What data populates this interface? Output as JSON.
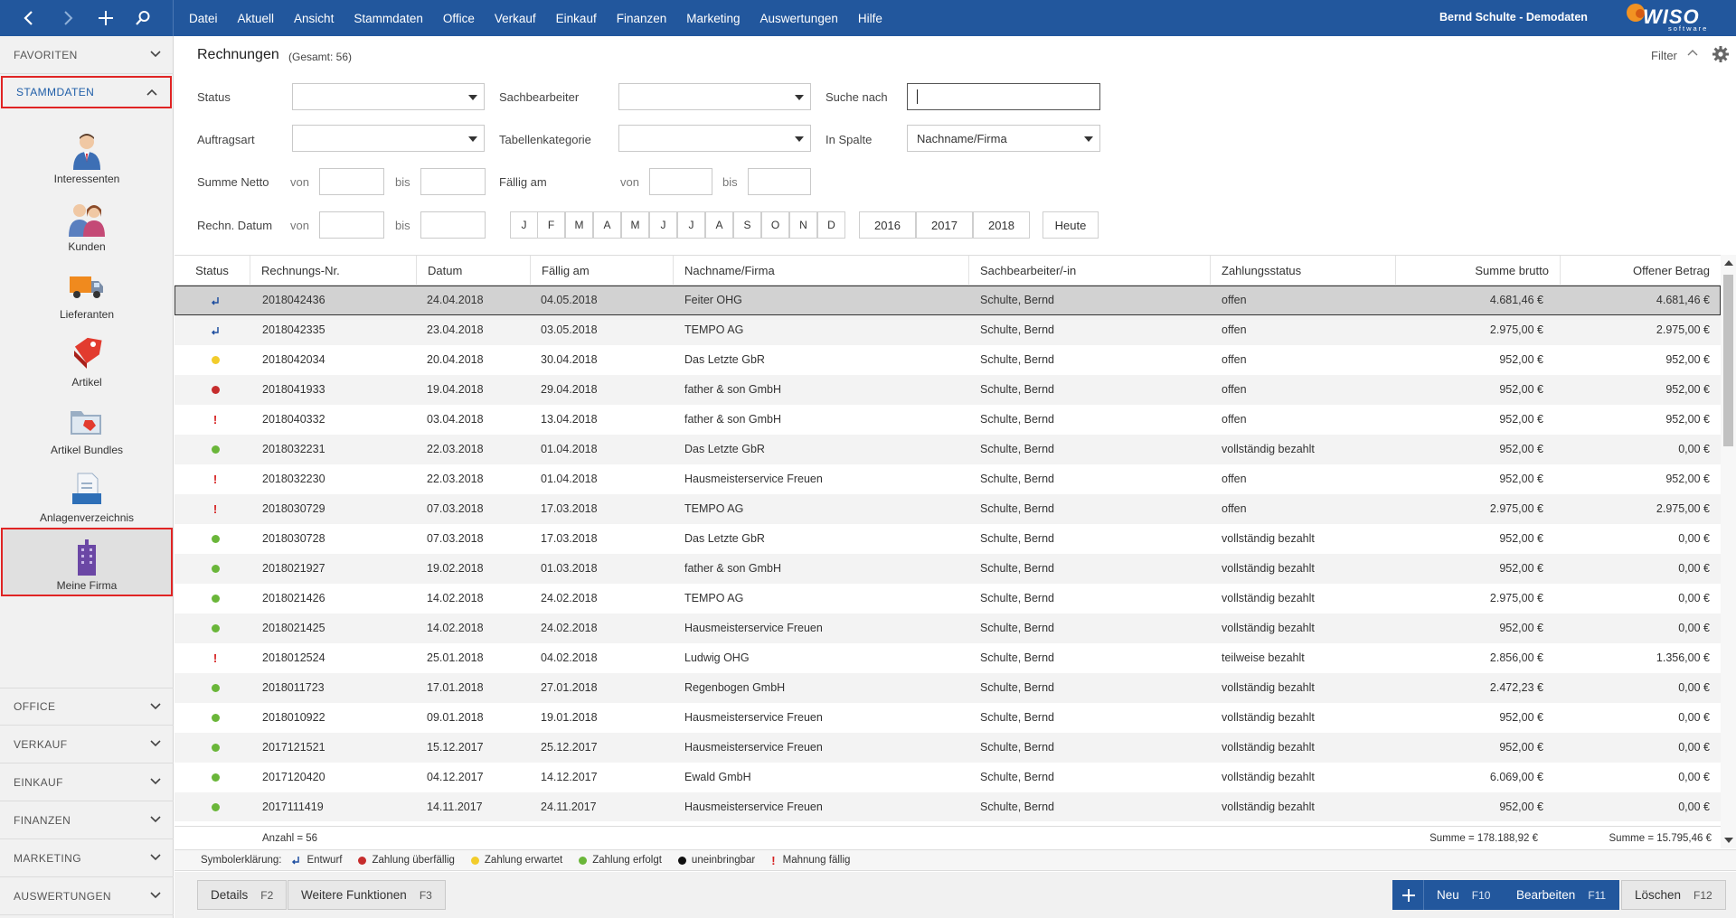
{
  "topbar": {
    "menu": [
      "Datei",
      "Aktuell",
      "Ansicht",
      "Stammdaten",
      "Office",
      "Verkauf",
      "Einkauf",
      "Finanzen",
      "Marketing",
      "Auswertungen",
      "Hilfe"
    ],
    "user": "Bernd Schulte - Demodaten",
    "logo": "WISO",
    "logo_sub": "software"
  },
  "sidebar": {
    "favoriten": "FAVORITEN",
    "stammdaten": "STAMMDATEN",
    "items": [
      "Interessenten",
      "Kunden",
      "Lieferanten",
      "Artikel",
      "Artikel Bundles",
      "Anlagenverzeichnis",
      "Meine Firma"
    ],
    "bottom": [
      "OFFICE",
      "VERKAUF",
      "EINKAUF",
      "FINANZEN",
      "MARKETING",
      "AUSWERTUNGEN"
    ]
  },
  "header": {
    "title": "Rechnungen",
    "total": "(Gesamt: 56)",
    "filter": "Filter"
  },
  "filters": {
    "status": "Status",
    "sachbearbeiter": "Sachbearbeiter",
    "suche_nach": "Suche nach",
    "auftragsart": "Auftragsart",
    "tabellenkategorie": "Tabellenkategorie",
    "in_spalte": "In Spalte",
    "in_spalte_value": "Nachname/Firma",
    "summe_netto": "Summe Netto",
    "faellig_am": "Fällig am",
    "rechn_datum": "Rechn. Datum",
    "von": "von",
    "bis": "bis",
    "months": [
      "J",
      "F",
      "M",
      "A",
      "M",
      "J",
      "J",
      "A",
      "S",
      "O",
      "N",
      "D"
    ],
    "years": [
      "2016",
      "2017",
      "2018"
    ],
    "heute": "Heute"
  },
  "table": {
    "columns": [
      "Status",
      "Rechnungs-Nr.",
      "Datum",
      "Fällig am",
      "Nachname/Firma",
      "Sachbearbeiter/-in",
      "Zahlungsstatus",
      "Summe brutto",
      "Offener Betrag"
    ],
    "rows": [
      {
        "status": "entwurf",
        "nr": "2018042436",
        "datum": "24.04.2018",
        "faellig": "04.05.2018",
        "firma": "Feiter OHG",
        "bearbeiter": "Schulte, Bernd",
        "zstatus": "offen",
        "brutto": "4.681,46 €",
        "offen": "4.681,46 €"
      },
      {
        "status": "entwurf",
        "nr": "2018042335",
        "datum": "23.04.2018",
        "faellig": "03.05.2018",
        "firma": "TEMPO AG",
        "bearbeiter": "Schulte, Bernd",
        "zstatus": "offen",
        "brutto": "2.975,00 €",
        "offen": "2.975,00 €"
      },
      {
        "status": "erwartet",
        "nr": "2018042034",
        "datum": "20.04.2018",
        "faellig": "30.04.2018",
        "firma": "Das Letzte GbR",
        "bearbeiter": "Schulte, Bernd",
        "zstatus": "offen",
        "brutto": "952,00 €",
        "offen": "952,00 €"
      },
      {
        "status": "ueberfaellig",
        "nr": "2018041933",
        "datum": "19.04.2018",
        "faellig": "29.04.2018",
        "firma": "father & son GmbH",
        "bearbeiter": "Schulte, Bernd",
        "zstatus": "offen",
        "brutto": "952,00 €",
        "offen": "952,00 €"
      },
      {
        "status": "mahnung",
        "nr": "2018040332",
        "datum": "03.04.2018",
        "faellig": "13.04.2018",
        "firma": "father & son GmbH",
        "bearbeiter": "Schulte, Bernd",
        "zstatus": "offen",
        "brutto": "952,00 €",
        "offen": "952,00 €"
      },
      {
        "status": "erfolgt",
        "nr": "2018032231",
        "datum": "22.03.2018",
        "faellig": "01.04.2018",
        "firma": "Das Letzte GbR",
        "bearbeiter": "Schulte, Bernd",
        "zstatus": "vollständig bezahlt",
        "brutto": "952,00 €",
        "offen": "0,00 €"
      },
      {
        "status": "mahnung",
        "nr": "2018032230",
        "datum": "22.03.2018",
        "faellig": "01.04.2018",
        "firma": "Hausmeisterservice Freuen",
        "bearbeiter": "Schulte, Bernd",
        "zstatus": "offen",
        "brutto": "952,00 €",
        "offen": "952,00 €"
      },
      {
        "status": "mahnung",
        "nr": "2018030729",
        "datum": "07.03.2018",
        "faellig": "17.03.2018",
        "firma": "TEMPO AG",
        "bearbeiter": "Schulte, Bernd",
        "zstatus": "offen",
        "brutto": "2.975,00 €",
        "offen": "2.975,00 €"
      },
      {
        "status": "erfolgt",
        "nr": "2018030728",
        "datum": "07.03.2018",
        "faellig": "17.03.2018",
        "firma": "Das Letzte GbR",
        "bearbeiter": "Schulte, Bernd",
        "zstatus": "vollständig bezahlt",
        "brutto": "952,00 €",
        "offen": "0,00 €"
      },
      {
        "status": "erfolgt",
        "nr": "2018021927",
        "datum": "19.02.2018",
        "faellig": "01.03.2018",
        "firma": "father & son GmbH",
        "bearbeiter": "Schulte, Bernd",
        "zstatus": "vollständig bezahlt",
        "brutto": "952,00 €",
        "offen": "0,00 €"
      },
      {
        "status": "erfolgt",
        "nr": "2018021426",
        "datum": "14.02.2018",
        "faellig": "24.02.2018",
        "firma": "TEMPO AG",
        "bearbeiter": "Schulte, Bernd",
        "zstatus": "vollständig bezahlt",
        "brutto": "2.975,00 €",
        "offen": "0,00 €"
      },
      {
        "status": "erfolgt",
        "nr": "2018021425",
        "datum": "14.02.2018",
        "faellig": "24.02.2018",
        "firma": "Hausmeisterservice Freuen",
        "bearbeiter": "Schulte, Bernd",
        "zstatus": "vollständig bezahlt",
        "brutto": "952,00 €",
        "offen": "0,00 €"
      },
      {
        "status": "mahnung",
        "nr": "2018012524",
        "datum": "25.01.2018",
        "faellig": "04.02.2018",
        "firma": "Ludwig OHG",
        "bearbeiter": "Schulte, Bernd",
        "zstatus": "teilweise bezahlt",
        "brutto": "2.856,00 €",
        "offen": "1.356,00 €"
      },
      {
        "status": "erfolgt",
        "nr": "2018011723",
        "datum": "17.01.2018",
        "faellig": "27.01.2018",
        "firma": "Regenbogen GmbH",
        "bearbeiter": "Schulte, Bernd",
        "zstatus": "vollständig bezahlt",
        "brutto": "2.472,23 €",
        "offen": "0,00 €"
      },
      {
        "status": "erfolgt",
        "nr": "2018010922",
        "datum": "09.01.2018",
        "faellig": "19.01.2018",
        "firma": "Hausmeisterservice Freuen",
        "bearbeiter": "Schulte, Bernd",
        "zstatus": "vollständig bezahlt",
        "brutto": "952,00 €",
        "offen": "0,00 €"
      },
      {
        "status": "erfolgt",
        "nr": "2017121521",
        "datum": "15.12.2017",
        "faellig": "25.12.2017",
        "firma": "Hausmeisterservice Freuen",
        "bearbeiter": "Schulte, Bernd",
        "zstatus": "vollständig bezahlt",
        "brutto": "952,00 €",
        "offen": "0,00 €"
      },
      {
        "status": "erfolgt",
        "nr": "2017120420",
        "datum": "04.12.2017",
        "faellig": "14.12.2017",
        "firma": "Ewald GmbH",
        "bearbeiter": "Schulte, Bernd",
        "zstatus": "vollständig bezahlt",
        "brutto": "6.069,00 €",
        "offen": "0,00 €"
      },
      {
        "status": "erfolgt",
        "nr": "2017111419",
        "datum": "14.11.2017",
        "faellig": "24.11.2017",
        "firma": "Hausmeisterservice Freuen",
        "bearbeiter": "Schulte, Bernd",
        "zstatus": "vollständig bezahlt",
        "brutto": "952,00 €",
        "offen": "0,00 €"
      }
    ],
    "anzahl": "Anzahl = 56",
    "summe_brutto": "Summe = 178.188,92 €",
    "summe_offen": "Summe = 15.795,46 €"
  },
  "legend": {
    "title": "Symbolerklärung:",
    "entwurf": "Entwurf",
    "ueberfaellig": "Zahlung überfällig",
    "erwartet": "Zahlung erwartet",
    "erfolgt": "Zahlung erfolgt",
    "uneinbringbar": "uneinbringbar",
    "mahnung": "Mahnung fällig"
  },
  "footer": {
    "details": "Details",
    "details_key": "F2",
    "weitere": "Weitere Funktionen",
    "weitere_key": "F3",
    "neu": "Neu",
    "neu_key": "F10",
    "bearbeiten": "Bearbeiten",
    "bearbeiten_key": "F11",
    "loeschen": "Löschen",
    "loeschen_key": "F12"
  },
  "colors": {
    "accent": "#22579d",
    "highlight": "#e02424",
    "ueberfaellig": "#c62d2d",
    "erwartet": "#f2cc2b",
    "erfolgt": "#6ab639",
    "uneinbringbar": "#111111",
    "mahnung": "#d51f1f"
  }
}
